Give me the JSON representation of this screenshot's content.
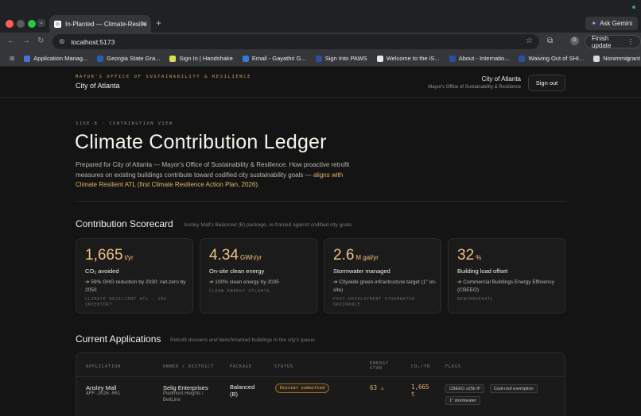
{
  "browser": {
    "tab_title": "In-Planted — Climate-Resilie",
    "url": "localhost:5173",
    "ask_gemini": "Ask Gemini",
    "finish_update": "Finish update",
    "profile_initial": "G",
    "bookmarks": [
      {
        "label": "Application Manag...",
        "color": "#4a6fd6"
      },
      {
        "label": "Georgia State Gra...",
        "color": "#2a5bb5"
      },
      {
        "label": "Sign In | Handshake",
        "color": "#d8e04a"
      },
      {
        "label": "Email - Gayathri G...",
        "color": "#2d7fd6"
      },
      {
        "label": "Sign Into PAWS",
        "color": "#2a4fa0"
      },
      {
        "label": "Welcome to the iS...",
        "color": "#e8e8e8"
      },
      {
        "label": "About - Internatio...",
        "color": "#2a4fa0"
      },
      {
        "label": "Waiving Out of SHI...",
        "color": "#2a4fa0"
      },
      {
        "label": "Nonimmigrant Vis...",
        "color": "#d9d9d9"
      }
    ]
  },
  "header": {
    "org_kicker": "MAYOR'S OFFICE OF SUSTAINABILITY & RESILIENCE",
    "org_name": "City of Atlanta",
    "user_city": "City of Atlanta",
    "user_office": "Mayor's Office of Sustainability & Resilience",
    "signout": "Sign out"
  },
  "hero": {
    "kicker": "SIDE-B · CONTRIBUTION VIEW",
    "title": "Climate Contribution Ledger",
    "intro_plain": "Prepared for City of Atlanta — Mayor's Office of Sustainability & Resilience. How proactive retrofit measures on existing buildings contribute toward codified city sustainability goals — ",
    "intro_highlight": "aligns with Climate Resilient ATL (first Climate Resilience Action Plan, 2026)",
    "intro_end": "."
  },
  "scorecard": {
    "title": "Contribution Scorecard",
    "subtitle": "Ansley Mall's Balanced (B) package, re-framed against codified city goals.",
    "cards": [
      {
        "value": "1,665",
        "unit": "t/yr",
        "label": "CO₂ avoided",
        "note": "59% GHG reduction by 2030; net-zero by 2050",
        "source": "CLIMATE RESILIENT ATL — GHG INVENTORY"
      },
      {
        "value": "4.34",
        "unit": "GWh/yr",
        "label": "On-site clean energy",
        "note": "100% clean energy by 2035",
        "source": "CLEAN ENERGY ATLANTA"
      },
      {
        "value": "2.6",
        "unit": "M gal/yr",
        "label": "Stormwater managed",
        "note": "Citywide green-infrastructure target (1\" on-site)",
        "source": "POST-DEVELOPMENT STORMWATER ORDINANCE"
      },
      {
        "value": "32",
        "unit": "%",
        "label": "Building load offset",
        "note": "Commercial Buildings Energy Efficiency (CBEEO)",
        "source": "BENCHMARKATL"
      }
    ]
  },
  "applications": {
    "title": "Current Applications",
    "subtitle": "Retrofit dossiers and benchmarked buildings in the city's queue.",
    "columns": {
      "application": "APPLICATION",
      "owner": "OWNER / DISTRICT",
      "package": "PACKAGE",
      "status": "STATUS",
      "energy_star_1": "ENERGY",
      "energy_star_2": "STAR",
      "co2": "CO₂/YR",
      "flags": "FLAGS"
    },
    "rows": [
      {
        "name": "Ansley Mall",
        "id": "APP-2026-001",
        "owner": "Selig Enterprises",
        "district": "Piedmont Heights / BeltLine",
        "package_line1": "Balanced",
        "package_line2": "(B)",
        "status": "Dossier submitted",
        "energy_star": "63 ⚠",
        "co2_line1": "1,665",
        "co2_line2": "t",
        "flags": [
          "CBEEO ≥25k ft²",
          "Cool-roof exemption",
          "1\" stormwater"
        ]
      }
    ]
  }
}
